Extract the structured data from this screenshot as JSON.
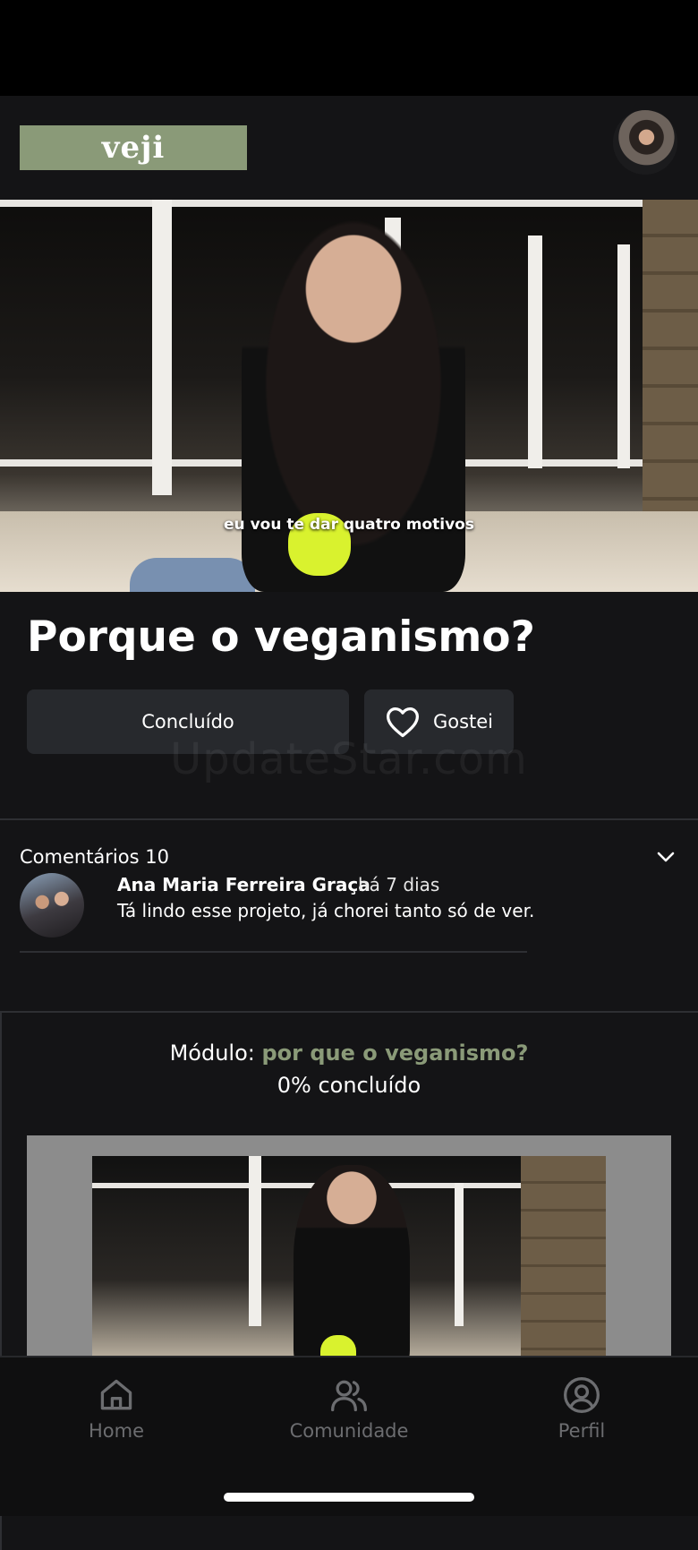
{
  "app": {
    "logo_text": "veji"
  },
  "video": {
    "subtitle": "eu vou te dar quatro motivos"
  },
  "lesson": {
    "title": "Porque o veganismo?",
    "done_label": "Concluído",
    "like_label": "Gostei",
    "like_icon": "heart-icon"
  },
  "watermark": "UpdateStar.com",
  "comments": {
    "header": "Comentários 10",
    "toggle_icon": "chevron-down-icon",
    "items": [
      {
        "author": "Ana Maria Ferreira Graça",
        "time": "há 7 dias",
        "text": "Tá lindo esse projeto, já chorei tanto só de ver."
      }
    ]
  },
  "module": {
    "prefix": "Módulo:",
    "name": "por que o veganismo?",
    "progress": "0% concluído"
  },
  "tabs": [
    {
      "label": "Home",
      "icon": "home-icon"
    },
    {
      "label": "Comunidade",
      "icon": "users-icon"
    },
    {
      "label": "Perfil",
      "icon": "user-circle-icon"
    }
  ],
  "colors": {
    "brand": "#8a9a78",
    "background": "#141416",
    "button": "#27292d",
    "tab_inactive": "#6c6d70"
  }
}
